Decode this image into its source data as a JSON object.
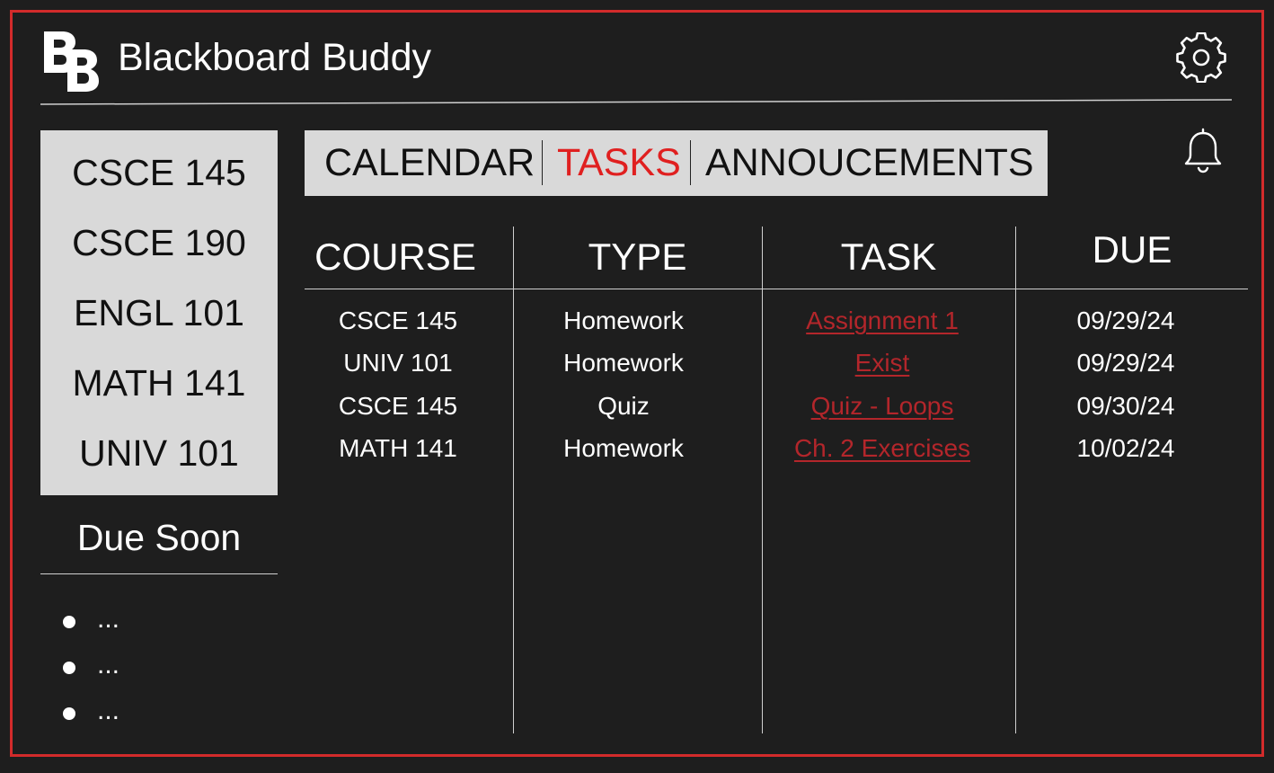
{
  "app": {
    "title": "Blackboard Buddy",
    "logo_letters": "BB",
    "accent_color": "#d22b2b"
  },
  "icons": {
    "settings": "gear-icon",
    "notifications": "bell-icon"
  },
  "sidebar": {
    "courses": [
      "CSCE 145",
      "CSCE 190",
      "ENGL 101",
      "MATH 141",
      "UNIV 101"
    ],
    "due_soon_title": "Due Soon",
    "due_soon_items": [
      "...",
      "...",
      "..."
    ]
  },
  "tabs": [
    {
      "label": "CALENDAR",
      "active": false
    },
    {
      "label": "TASKS",
      "active": true
    },
    {
      "label": "ANNOUCEMENTS",
      "active": false
    }
  ],
  "table": {
    "headers": [
      "COURSE",
      "TYPE",
      "TASK",
      "DUE"
    ],
    "rows": [
      {
        "course": "CSCE 145",
        "type": "Homework",
        "task": "Assignment 1",
        "due": "09/29/24"
      },
      {
        "course": "UNIV 101",
        "type": "Homework",
        "task": "Exist",
        "due": "09/29/24"
      },
      {
        "course": "CSCE 145",
        "type": "Quiz",
        "task": "Quiz - Loops",
        "due": "09/30/24"
      },
      {
        "course": "MATH 141",
        "type": "Homework",
        "task": "Ch. 2 Exercises",
        "due": "10/02/24"
      }
    ]
  }
}
